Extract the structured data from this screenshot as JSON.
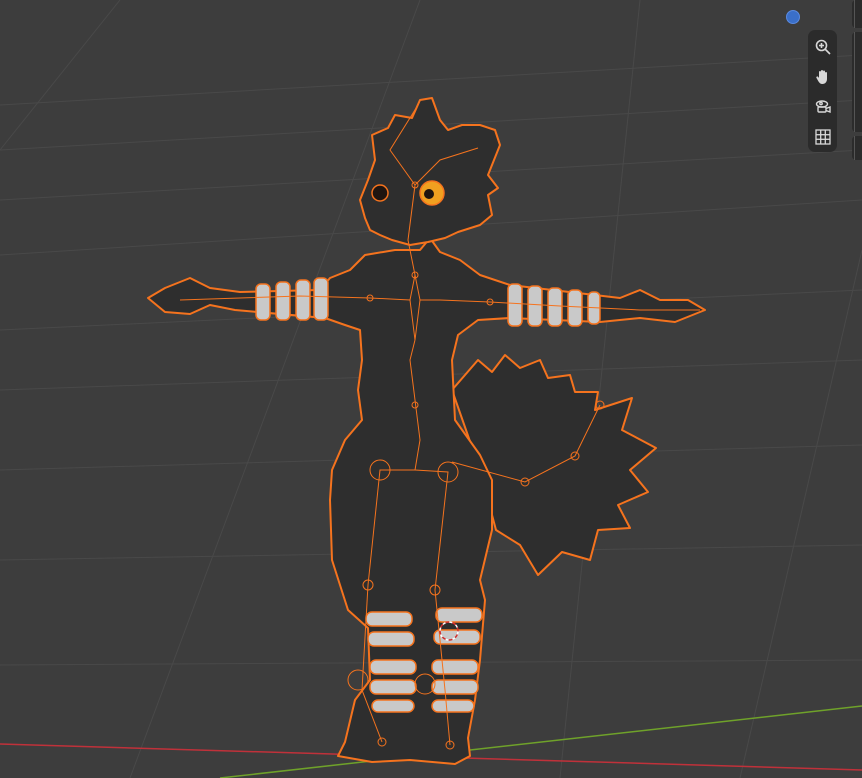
{
  "viewport": {
    "background": "#3d3d3d",
    "grid_color": "#4a4a4a",
    "x_axis_color": "#c0313a",
    "y_axis_color": "#6fa22a",
    "selection_outline_color": "#f5731e",
    "mesh_color": "#2e2e2e",
    "band_color": "#c9c9c9",
    "eye_color": "#f0a020"
  },
  "navigation_gizmo": {
    "axis_dot_color": "#3a6fc9",
    "tools": [
      {
        "name": "zoom",
        "icon": "zoom-in-icon"
      },
      {
        "name": "pan",
        "icon": "hand-icon"
      },
      {
        "name": "camera-view",
        "icon": "camera-icon"
      },
      {
        "name": "orthographic-toggle",
        "icon": "grid-icon"
      }
    ]
  }
}
